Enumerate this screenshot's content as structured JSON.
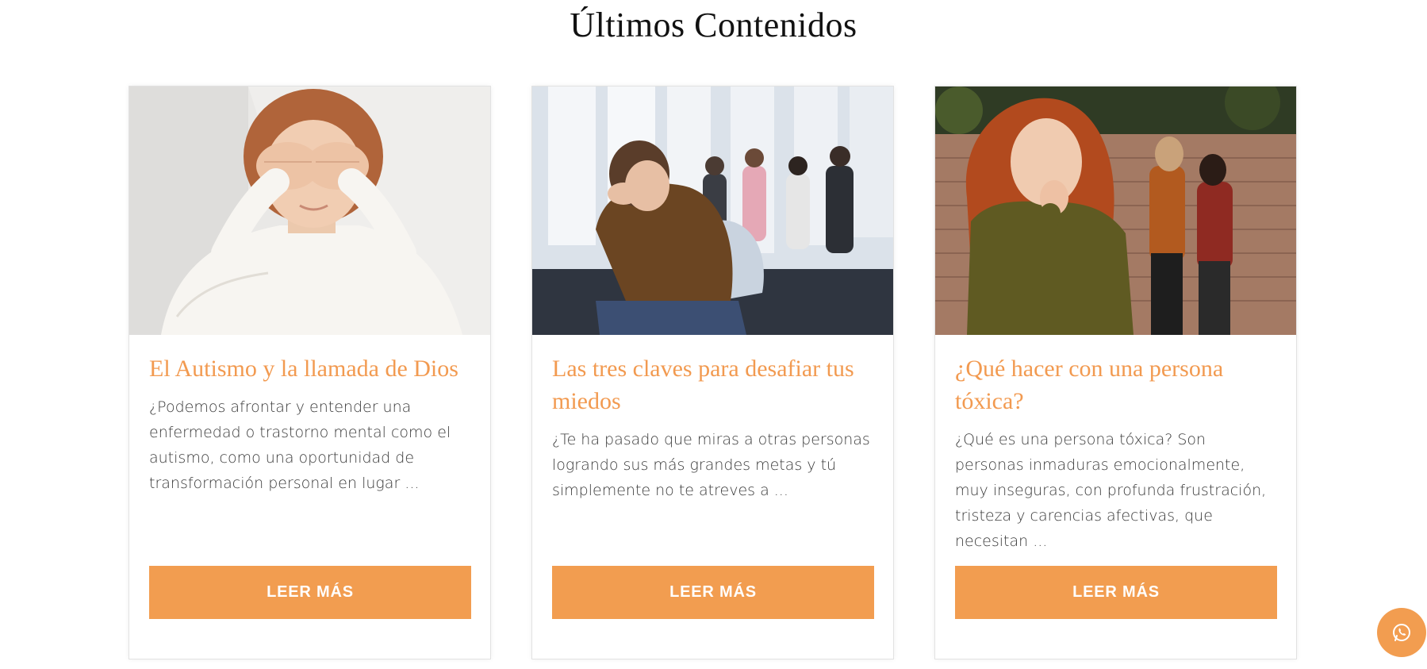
{
  "section": {
    "title": "Últimos Contenidos"
  },
  "cards": [
    {
      "title": "El Autismo y la llamada de Dios",
      "excerpt": "¿Podemos afrontar y entender una enfermedad o trastorno mental como el autismo, como una oportunidad de transformación personal en lugar ...",
      "button_label": "LEER MÁS"
    },
    {
      "title": "Las tres claves para desafiar tus miedos",
      "excerpt": "¿Te ha pasado que miras a otras personas logrando sus más grandes metas y tú simplemente no te atreves a ...",
      "button_label": "LEER MÁS"
    },
    {
      "title": "¿Qué hacer con una persona tóxica?",
      "excerpt": "¿Qué es una persona tóxica? Son personas inmaduras emocionalmente, muy inseguras, con profunda frustración, tristeza y carencias afectivas, que necesitan ...",
      "button_label": "LEER MÁS"
    }
  ],
  "colors": {
    "accent": "#f29d50",
    "title_accent": "#f29a50",
    "heading": "#121212",
    "body_text": "#3a3a3a"
  },
  "icons": {
    "floating_button": "whatsapp-icon"
  }
}
